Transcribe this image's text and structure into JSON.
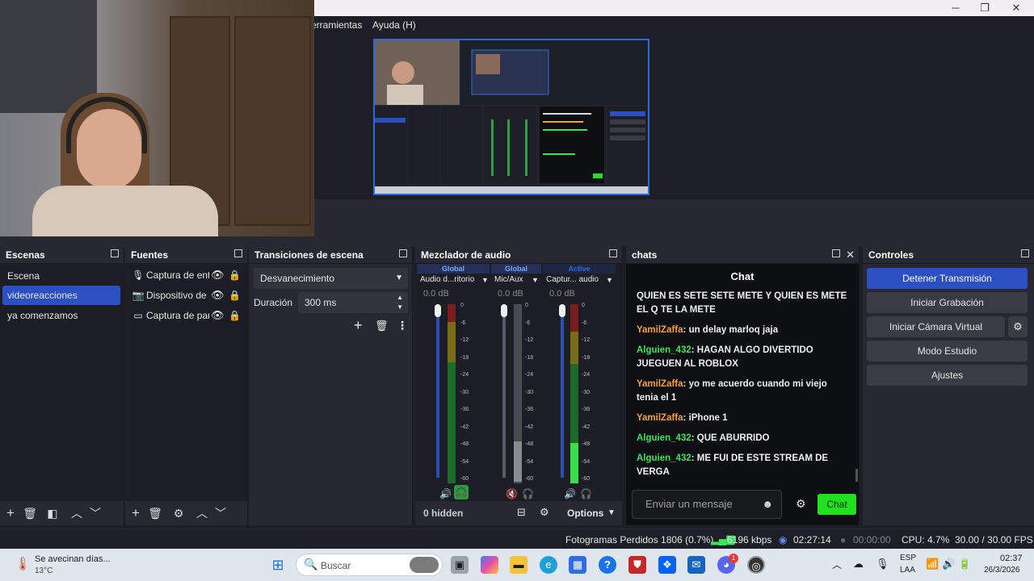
{
  "menu": {
    "tools": "erramientas",
    "help": "Ayuda (H)"
  },
  "window_buttons": {
    "minimize": "─",
    "maximize": "❐",
    "close": "✕"
  },
  "scenes": {
    "title": "Escenas",
    "items": [
      "Escena",
      "videoreacciones",
      "ya comenzamos"
    ],
    "selected": "videoreacciones"
  },
  "sources": {
    "title": "Fuentes",
    "items": [
      {
        "icon": "microphone-icon",
        "name": "Captura de ent"
      },
      {
        "icon": "camera-icon",
        "name": "Dispositivo de"
      },
      {
        "icon": "monitor-icon",
        "name": "Captura de par"
      }
    ]
  },
  "transitions": {
    "title": "Transiciones de escena",
    "selected": "Desvanecimiento",
    "duration_label": "Duración",
    "duration_value": "300 ms"
  },
  "mixer": {
    "title": "Mezclador de audio",
    "channels": [
      {
        "tag": "Global",
        "name": "Audio d...ritorio",
        "db": "0.0 dB",
        "muted": false
      },
      {
        "tag": "Global",
        "name": "Mic/Aux",
        "db": "0.0 dB",
        "muted": true
      },
      {
        "tag": "Active",
        "name": "Captur... audio",
        "db": "0.0 dB",
        "muted": false
      }
    ],
    "scale": [
      "0",
      "-6",
      "-12",
      "-18",
      "-24",
      "-30",
      "-36",
      "-42",
      "-48",
      "-54",
      "-60"
    ],
    "hidden_label": "0 hidden",
    "options_label": "Options"
  },
  "chat": {
    "dock_title": "chats",
    "header": "Chat",
    "messages": [
      {
        "user": "",
        "text": "QUIEN ES SETE SETE METE Y QUIEN ES METE EL Q TE LA METE"
      },
      {
        "user": "YamilZaffa",
        "text": "un delay marloq jaja"
      },
      {
        "user": "Alguien_432",
        "text": "HAGAN ALGO DIVERTIDO JUEGUEN AL ROBLOX"
      },
      {
        "user": "YamilZaffa",
        "text": "yo me acuerdo cuando mi viejo tenia el 1"
      },
      {
        "user": "YamilZaffa",
        "text": "iPhone 1"
      },
      {
        "user": "Alguien_432",
        "text": "QUE ABURRIDO"
      },
      {
        "user": "Alguien_432",
        "text": "ME FUI DE ESTE STREAM DE VERGA"
      }
    ],
    "input_placeholder": "Enviar un mensaje",
    "send_label": "Chat"
  },
  "controls": {
    "title": "Controles",
    "stop_stream": "Detener Transmisión",
    "start_recording": "Iniciar Grabación",
    "virtual_camera": "Iniciar Cámara Virtual",
    "studio_mode": "Modo Estudio",
    "settings": "Ajustes"
  },
  "status": {
    "dropped": "Fotogramas Perdidos 1806 (0.7%)",
    "bitrate": "6196 kbps",
    "stream_time": "02:27:14",
    "rec_time": "00:00:00",
    "cpu": "CPU: 4.7%",
    "fps": "30.00 / 30.00 FPS"
  },
  "taskbar": {
    "weather_title": "Se avecinan días...",
    "weather_temp": "13°C",
    "search_placeholder": "Buscar",
    "lang_top": "ESP",
    "lang_bottom": "LAA",
    "time": "02:37",
    "date": "26/3/2026",
    "discord_badge": "1"
  }
}
